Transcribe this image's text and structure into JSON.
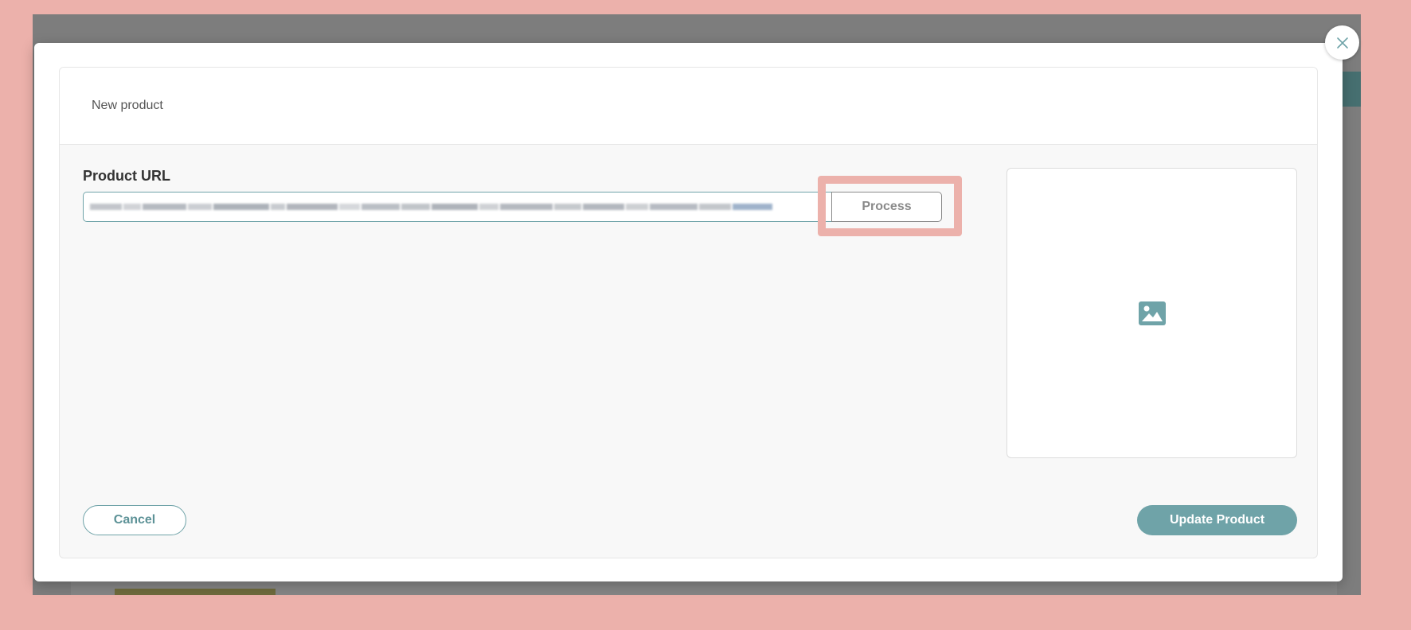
{
  "modal": {
    "title": "New product",
    "product_url_label": "Product URL",
    "product_url_value": "https://www.example.com/product/blurred-url",
    "process_label": "Process",
    "image_placeholder_icon": "image-icon",
    "cancel_label": "Cancel",
    "update_label": "Update Product",
    "close_icon": "close-icon"
  },
  "colors": {
    "accent": "#6fa3a8",
    "highlight": "#ecb1ab",
    "overlay": "#7d7d7d"
  }
}
